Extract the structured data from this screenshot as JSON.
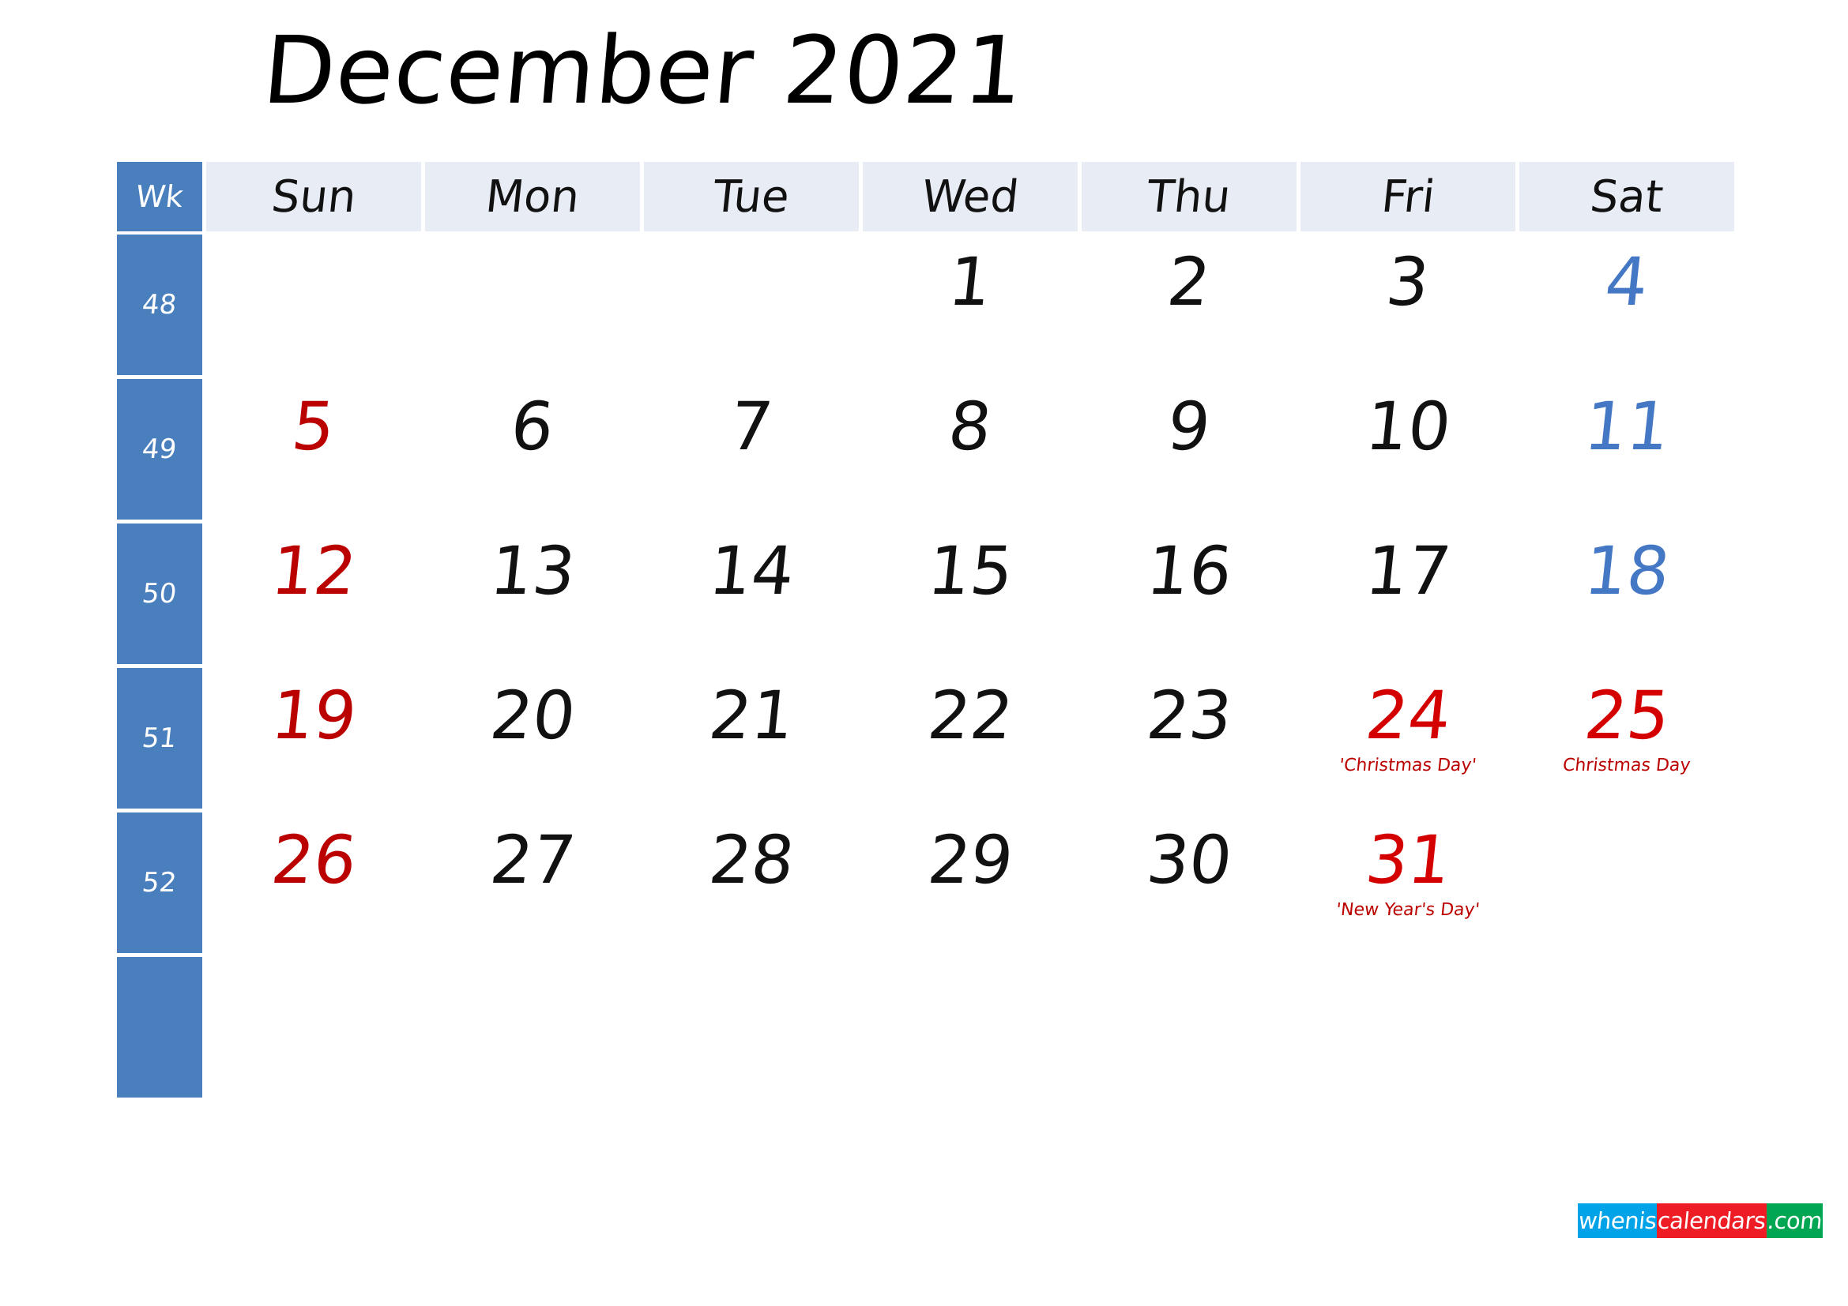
{
  "title": "December 2021",
  "colors": {
    "week_column_bg": "#4a7fbe",
    "header_cell_bg": "#e8edf5",
    "sunday_text": "#bb0000",
    "saturday_text": "#4477c4",
    "weekday_text": "#111111",
    "holiday_text": "#d40000",
    "logo_blue": "#00a2e8",
    "logo_red": "#ee1c24",
    "logo_green": "#00a651"
  },
  "header": {
    "week_label": "Wk",
    "days": [
      "Sun",
      "Mon",
      "Tue",
      "Wed",
      "Thu",
      "Fri",
      "Sat"
    ]
  },
  "weeks": [
    {
      "wk": "48",
      "days": [
        {
          "num": "",
          "event": ""
        },
        {
          "num": "",
          "event": ""
        },
        {
          "num": "",
          "event": ""
        },
        {
          "num": "1",
          "event": ""
        },
        {
          "num": "2",
          "event": ""
        },
        {
          "num": "3",
          "event": ""
        },
        {
          "num": "4",
          "event": ""
        }
      ]
    },
    {
      "wk": "49",
      "days": [
        {
          "num": "5",
          "event": ""
        },
        {
          "num": "6",
          "event": ""
        },
        {
          "num": "7",
          "event": ""
        },
        {
          "num": "8",
          "event": ""
        },
        {
          "num": "9",
          "event": ""
        },
        {
          "num": "10",
          "event": ""
        },
        {
          "num": "11",
          "event": ""
        }
      ]
    },
    {
      "wk": "50",
      "days": [
        {
          "num": "12",
          "event": ""
        },
        {
          "num": "13",
          "event": ""
        },
        {
          "num": "14",
          "event": ""
        },
        {
          "num": "15",
          "event": ""
        },
        {
          "num": "16",
          "event": ""
        },
        {
          "num": "17",
          "event": ""
        },
        {
          "num": "18",
          "event": ""
        }
      ]
    },
    {
      "wk": "51",
      "days": [
        {
          "num": "19",
          "event": ""
        },
        {
          "num": "20",
          "event": ""
        },
        {
          "num": "21",
          "event": ""
        },
        {
          "num": "22",
          "event": ""
        },
        {
          "num": "23",
          "event": ""
        },
        {
          "num": "24",
          "event": "'Christmas Day'",
          "holiday": true
        },
        {
          "num": "25",
          "event": "Christmas Day",
          "holiday": true
        }
      ]
    },
    {
      "wk": "52",
      "days": [
        {
          "num": "26",
          "event": ""
        },
        {
          "num": "27",
          "event": ""
        },
        {
          "num": "28",
          "event": ""
        },
        {
          "num": "29",
          "event": ""
        },
        {
          "num": "30",
          "event": ""
        },
        {
          "num": "31",
          "event": "'New Year's Day'",
          "holiday": true
        },
        {
          "num": "",
          "event": ""
        }
      ]
    },
    {
      "wk": "",
      "days": [
        {
          "num": "",
          "event": ""
        },
        {
          "num": "",
          "event": ""
        },
        {
          "num": "",
          "event": ""
        },
        {
          "num": "",
          "event": ""
        },
        {
          "num": "",
          "event": ""
        },
        {
          "num": "",
          "event": ""
        },
        {
          "num": "",
          "event": ""
        }
      ]
    }
  ],
  "logo": {
    "part1": "whenis",
    "part2": "calendars",
    "part3": ".com"
  }
}
